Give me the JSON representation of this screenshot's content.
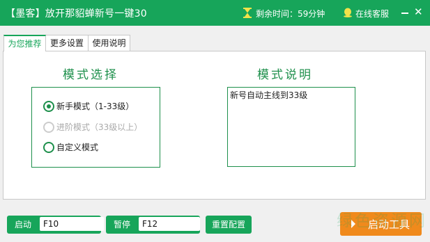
{
  "titlebar": {
    "title": "【墨客】放开那貂蝉新号一键30",
    "remaining": "剩余时间：59分钟",
    "service": "在线客服",
    "close_glyph": "✕"
  },
  "tabs": [
    "为您推荐",
    "更多设置",
    "使用说明"
  ],
  "mode_select": {
    "heading": "模式选择",
    "options": [
      {
        "label": "新手模式（1-33级）",
        "checked": true,
        "disabled": false
      },
      {
        "label": "进阶模式（33级以上）",
        "checked": false,
        "disabled": true
      },
      {
        "label": "自定义模式",
        "checked": false,
        "disabled": false
      }
    ]
  },
  "mode_desc": {
    "heading": "模式说明",
    "text": "新号自动主线到33级"
  },
  "bottom": {
    "start_label": "启动",
    "start_key": "F10",
    "pause_label": "暂停",
    "pause_key": "F12",
    "reset_label": "重置配置",
    "launch_label": "启动工具",
    "watermark": "绿色资源网"
  },
  "colors": {
    "accent": "#17a55a",
    "launch": "#f08a1c"
  }
}
